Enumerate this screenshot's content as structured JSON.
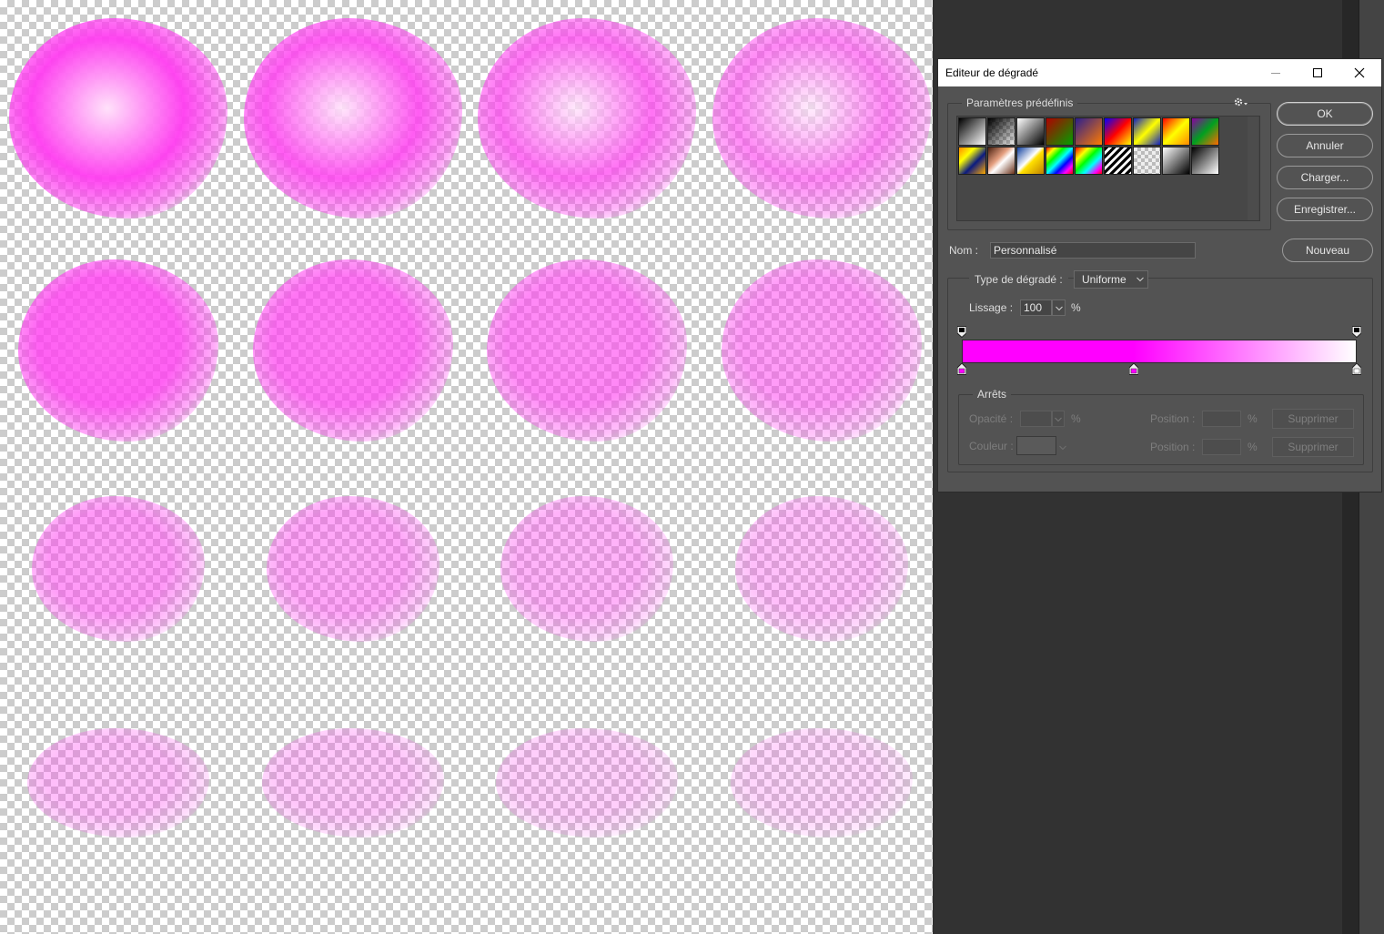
{
  "dialog": {
    "title": "Editeur de dégradé",
    "presets_label": "Paramètres prédéfinis",
    "buttons": {
      "ok": "OK",
      "cancel": "Annuler",
      "load": "Charger...",
      "save": "Enregistrer...",
      "new": "Nouveau"
    },
    "name_label": "Nom :",
    "name_value": "Personnalisé",
    "gradient_type_label": "Type de dégradé :",
    "gradient_type_value": "Uniforme",
    "smoothness_label": "Lissage :",
    "smoothness_value": "100",
    "percent": "%",
    "stops_label": "Arrêts",
    "opacity_label": "Opacité :",
    "color_label": "Couleur :",
    "position_label": "Position :",
    "delete_label": "Supprimer",
    "gradient_colors": [
      "#ff00ff",
      "#ff00ff",
      "#ffffff"
    ],
    "color_stops_percent": [
      0,
      43.5,
      100
    ],
    "opacity_stops_percent": [
      0,
      100
    ]
  },
  "icons": {
    "minimize": "minimize-icon",
    "maximize": "maximize-icon",
    "close": "close-icon",
    "gear": "gear-icon"
  },
  "canvas": {
    "accent_color": "#ff33ee"
  }
}
